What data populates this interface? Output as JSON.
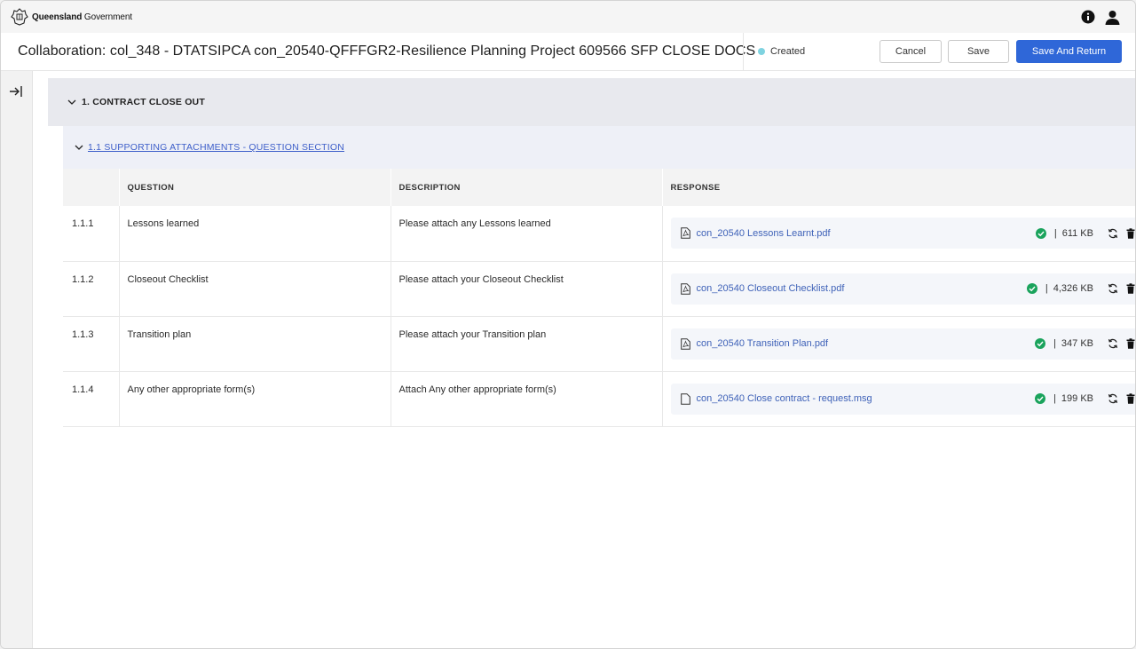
{
  "gov": {
    "brand_bold": "Queensland",
    "brand_rest": " Government"
  },
  "header": {
    "title": "Collaboration: col_348 - DTATSIPCA con_20540-QFFFGR2-Resilience Planning Project 609566 SFP CLOSE DOCS",
    "status": "Created",
    "status_color": "#7fd3e0",
    "cancel_label": "Cancel",
    "save_label": "Save",
    "save_return_label": "Save And Return",
    "primary_color": "#2f67d8"
  },
  "section": {
    "title": "1. CONTRACT CLOSE OUT"
  },
  "subsection": {
    "title": "1.1 SUPPORTING ATTACHMENTS - QUESTION SECTION"
  },
  "table": {
    "headers": {
      "num": "",
      "question": "QUESTION",
      "description": "DESCRIPTION",
      "response": "RESPONSE"
    },
    "rows": [
      {
        "num": "1.1.1",
        "question": "Lessons learned",
        "description": "Please attach any Lessons learned",
        "file": "con_20540 Lessons Learnt.pdf",
        "file_icon": "pdf-file-icon",
        "size": "611 KB"
      },
      {
        "num": "1.1.2",
        "question": "Closeout Checklist",
        "description": "Please attach your Closeout Checklist",
        "file": "con_20540 Closeout Checklist.pdf",
        "file_icon": "pdf-file-icon",
        "size": "4,326 KB"
      },
      {
        "num": "1.1.3",
        "question": "Transition plan",
        "description": "Please attach your Transition plan",
        "file": "con_20540 Transition Plan.pdf",
        "file_icon": "pdf-file-icon",
        "size": "347 KB"
      },
      {
        "num": "1.1.4",
        "question": "Any other appropriate form(s)",
        "description": "Attach Any other appropriate form(s)",
        "file": "con_20540 Close contract - request.msg",
        "file_icon": "generic-file-icon",
        "size": "199 KB"
      }
    ]
  },
  "colors": {
    "success": "#1aa35c",
    "link": "#3f62b8"
  }
}
